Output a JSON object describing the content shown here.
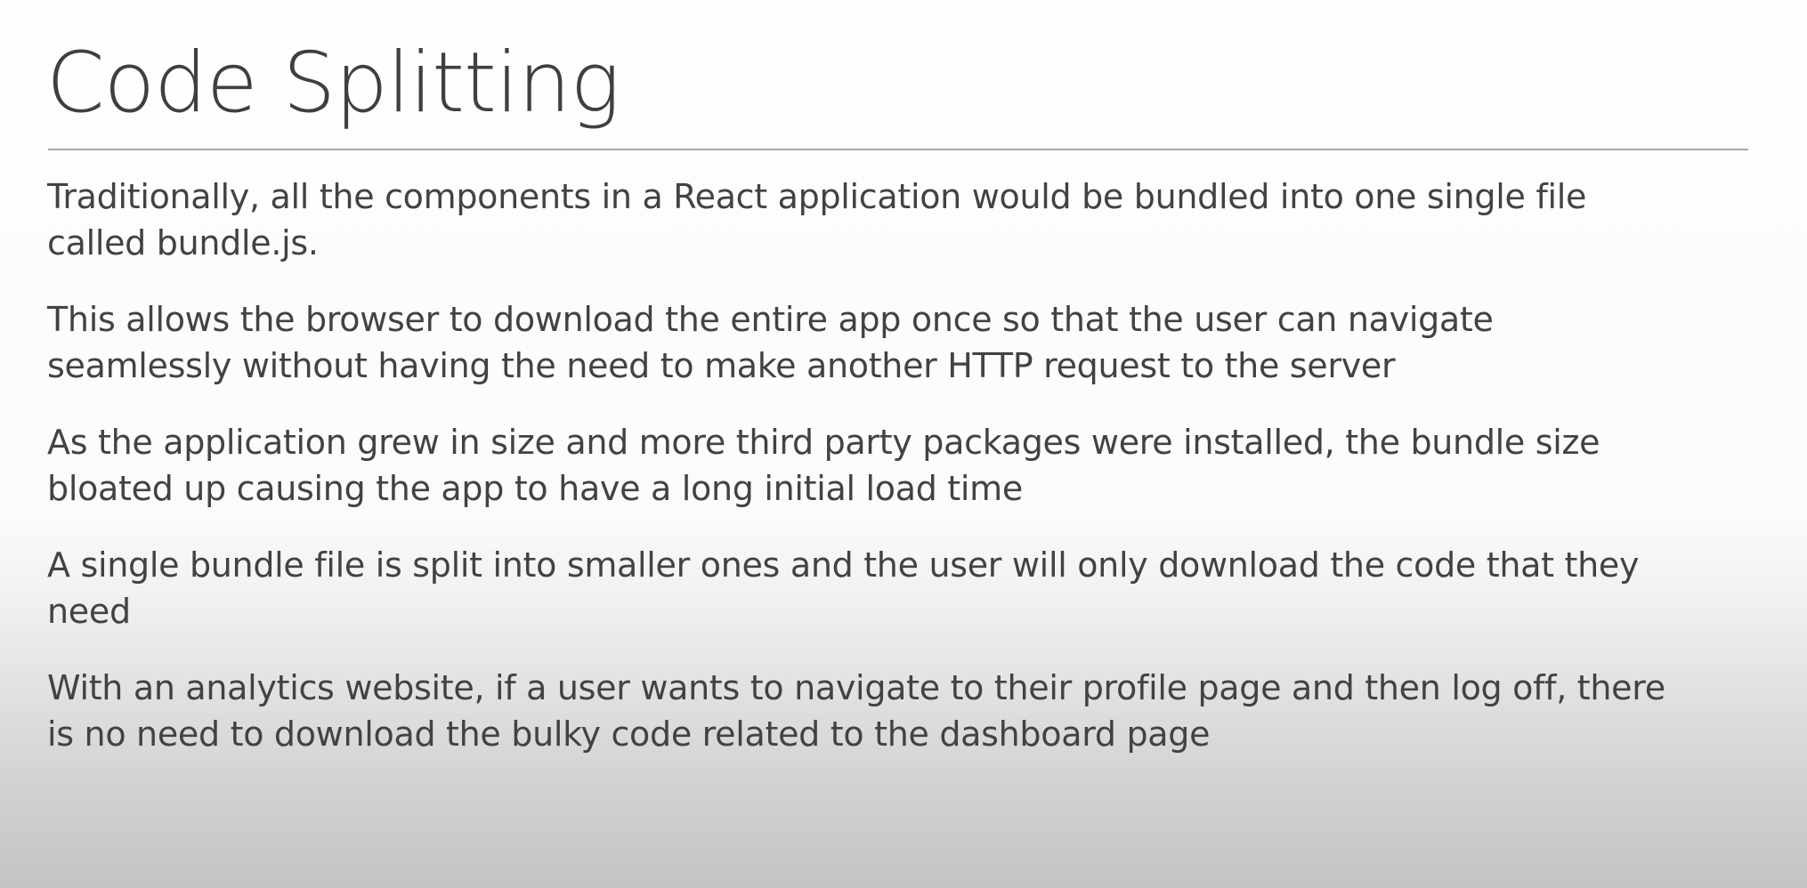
{
  "slide": {
    "title": "Code Splitting",
    "bullets": [
      {
        "line1": "Traditionally, all the components in a React application would be bundled into one single file",
        "line2": "called bundle.js."
      },
      {
        "line1": "This allows the browser to download the entire app once so that the user can navigate",
        "line2": "seamlessly without having the need to make another HTTP request to the server"
      },
      {
        "line1": "As the application grew in size and more third party packages were installed, the bundle size",
        "line2": "bloated up causing the app to have a long initial load time"
      },
      {
        "line1": "A single bundle file is split into smaller ones and the user will only download the code that they",
        "line2": "need"
      },
      {
        "line1": "With an analytics website, if a user wants to navigate to their profile page and then log off, there",
        "line2": "is no need to download the bulky code related to the dashboard page"
      }
    ]
  }
}
